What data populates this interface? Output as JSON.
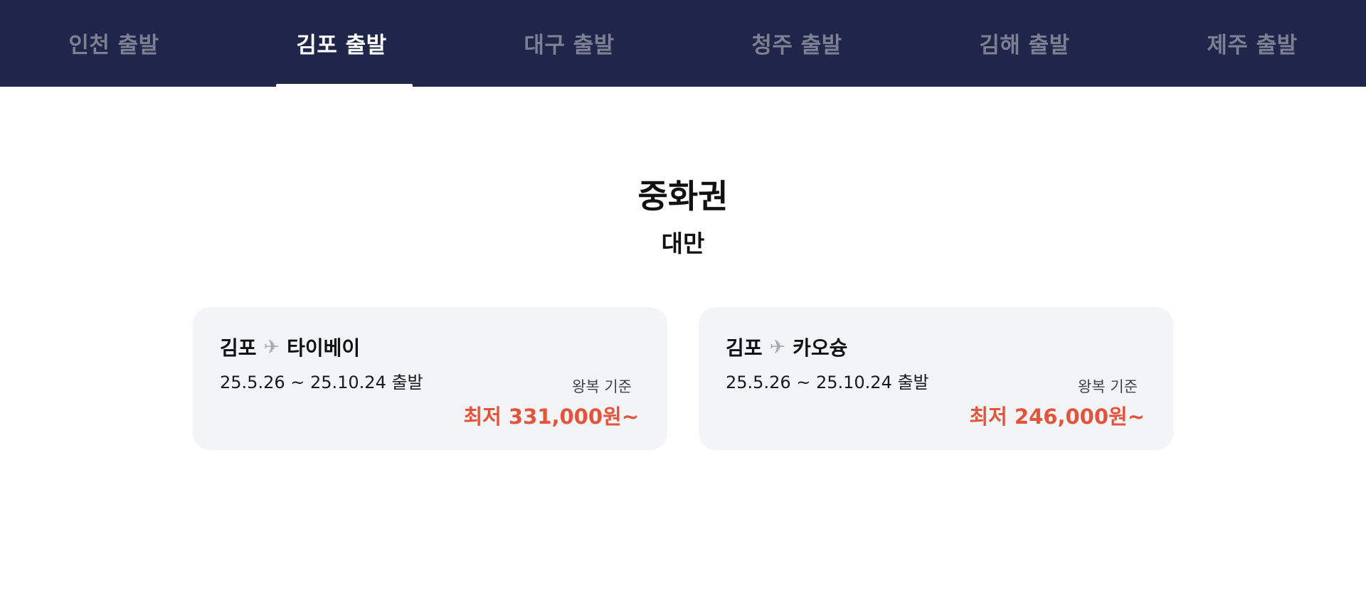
{
  "tabs": [
    {
      "label": "인천 출발",
      "active": false
    },
    {
      "label": "김포 출발",
      "active": true
    },
    {
      "label": "대구 출발",
      "active": false
    },
    {
      "label": "청주 출발",
      "active": false
    },
    {
      "label": "김해 출발",
      "active": false
    },
    {
      "label": "제주 출발",
      "active": false
    }
  ],
  "section": {
    "title": "중화권",
    "subtitle": "대만"
  },
  "cards": [
    {
      "origin": "김포",
      "plane_icon": "✈",
      "destination": "타이베이",
      "dates": "25.5.26 ~ 25.10.24 출발",
      "basis": "왕복 기준",
      "price": "최저 331,000원~"
    },
    {
      "origin": "김포",
      "plane_icon": "✈",
      "destination": "카오슝",
      "dates": "25.5.26 ~ 25.10.24 출발",
      "basis": "왕복 기준",
      "price": "최저 246,000원~"
    }
  ],
  "colors": {
    "header_bg": "#1f264a",
    "tab_inactive": "#7b8093",
    "tab_active": "#ffffff",
    "card_bg": "#f3f4f6",
    "price": "#e4533c",
    "plane_icon": "#a7abb3"
  }
}
